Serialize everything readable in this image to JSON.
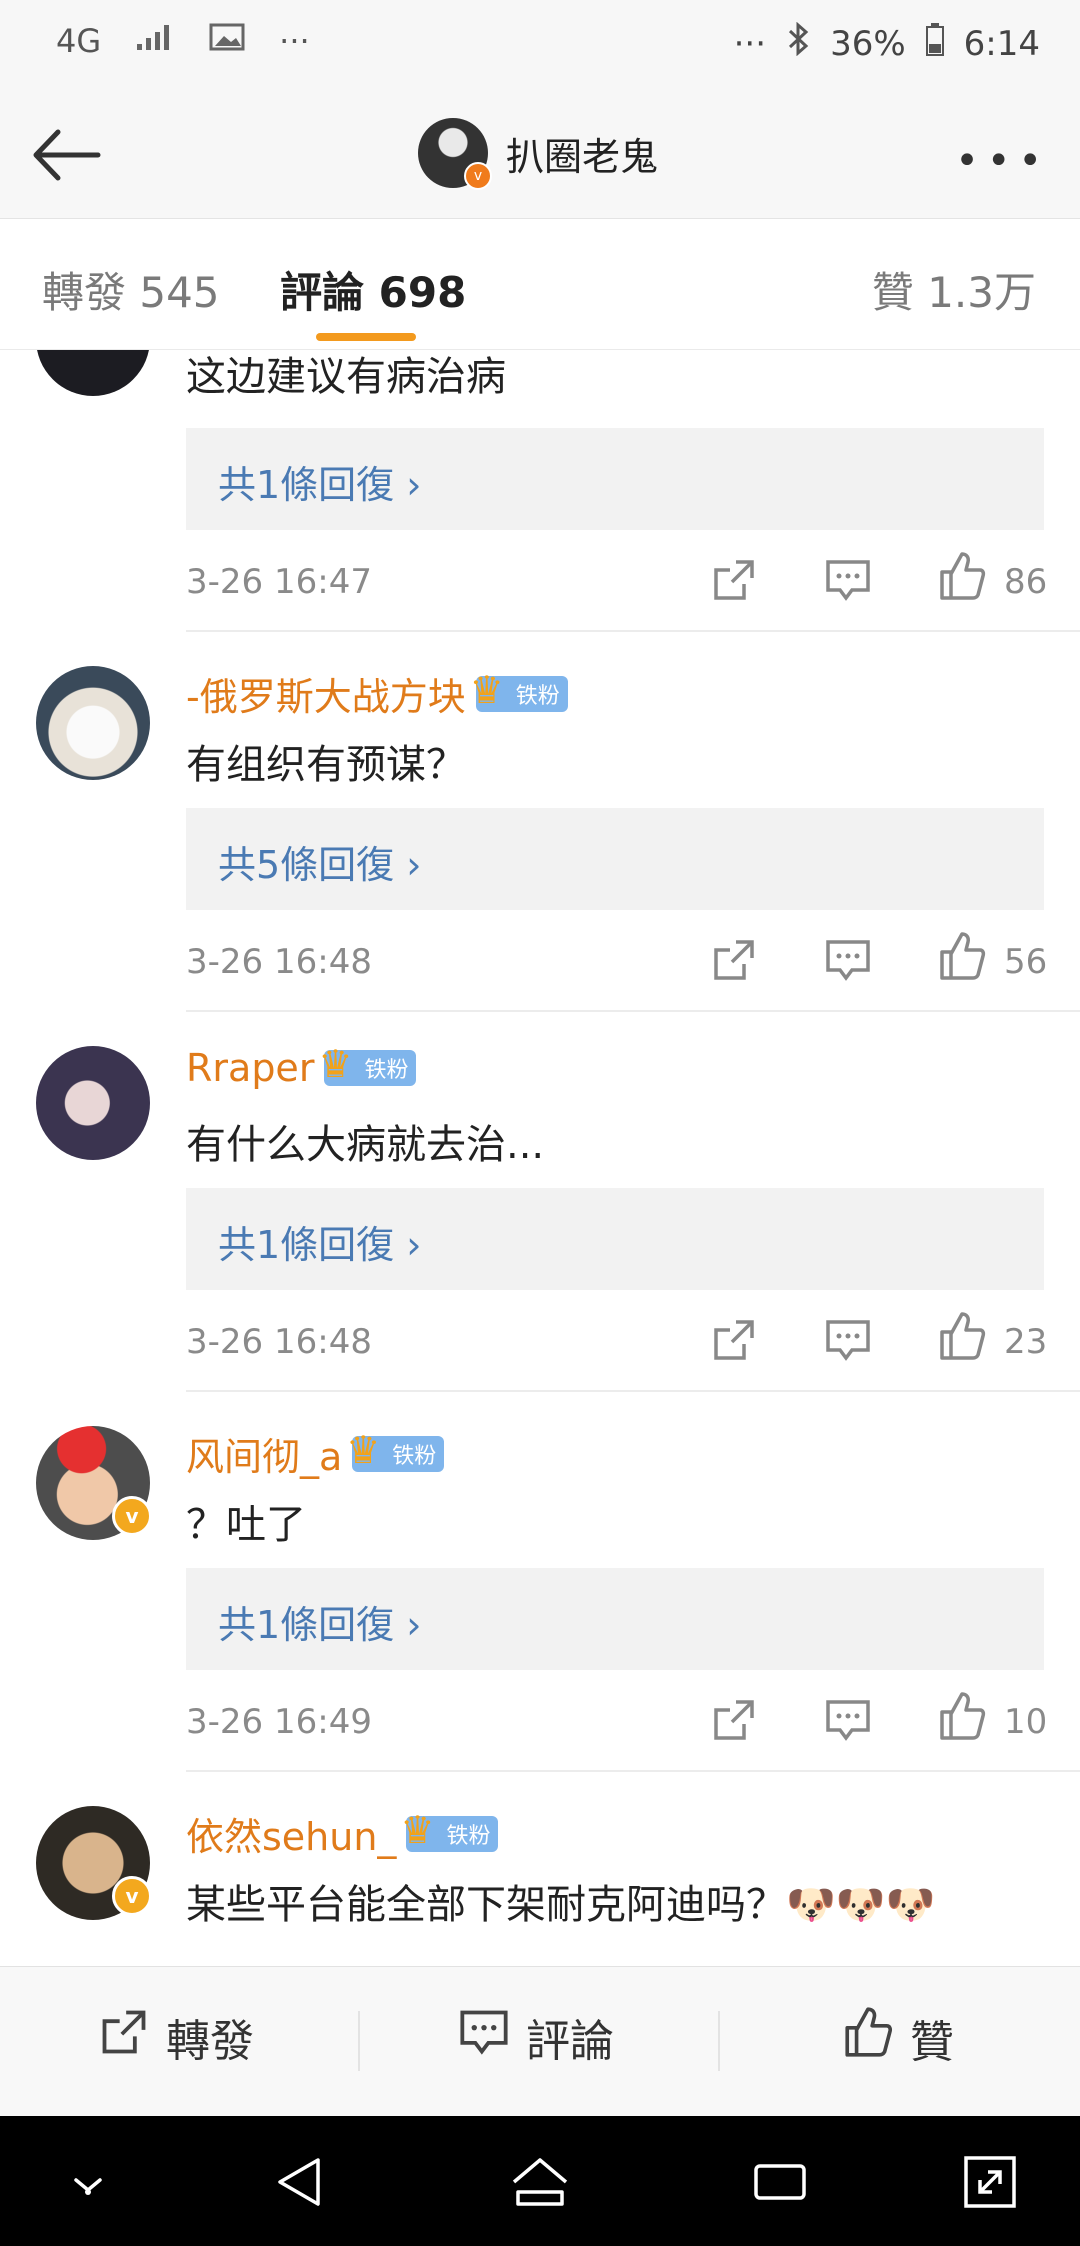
{
  "status_bar": {
    "network": "4G",
    "battery": "36%",
    "time": "6:14"
  },
  "header": {
    "title": "扒圈老鬼"
  },
  "tabs": [
    {
      "label": "轉發 545"
    },
    {
      "label": "評論 698"
    },
    {
      "label": "贊 1.3万"
    }
  ],
  "comments": [
    {
      "username": "",
      "badge": "",
      "text": "这边建议有病治病",
      "replies": "共1條回復",
      "time": "3-26 16:47",
      "likes": "86"
    },
    {
      "username": "-俄罗斯大战方块",
      "badge": "铁粉",
      "text": "有组织有预谋？",
      "replies": "共5條回復",
      "time": "3-26 16:48",
      "likes": "56"
    },
    {
      "username": "Rraper",
      "badge": "铁粉",
      "text": "有什么大病就去治...",
      "replies": "共1條回復",
      "time": "3-26 16:48",
      "likes": "23"
    },
    {
      "username": "风间彻_a",
      "badge": "铁粉",
      "text": "？吐了",
      "replies": "共1條回復",
      "time": "3-26 16:49",
      "likes": "10"
    },
    {
      "username": "依然sehun_",
      "badge": "铁粉",
      "text": "某些平台能全部下架耐克阿迪吗？🐶🐶🐶",
      "replies": "",
      "time": "",
      "likes": ""
    }
  ],
  "action_bar": {
    "repost": "轉發",
    "comment": "評論",
    "like": "贊"
  },
  "colors": {
    "accent": "#f39a1e",
    "username": "#e07b1a",
    "reply_link": "#4a7ab3",
    "fan_badge": "#7fb5ec"
  }
}
